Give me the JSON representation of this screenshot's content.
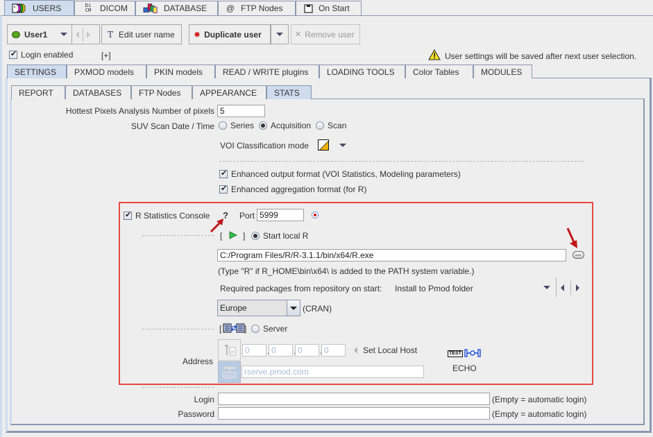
{
  "top_tabs": [
    {
      "label": "USERS",
      "icon": "users-faces-icon",
      "active": true
    },
    {
      "label": "DICOM",
      "icon": "dicom-icon",
      "active": false
    },
    {
      "label": "DATABASE",
      "icon": "database-icon",
      "active": false
    },
    {
      "label": "FTP Nodes",
      "icon": "at-sign-icon",
      "active": false
    },
    {
      "label": "On Start",
      "icon": "on-start-icon",
      "active": false
    }
  ],
  "toolbar": {
    "user_selected": "User1",
    "user_status_color": "#5aa51e",
    "edit_user_name": "Edit user name",
    "duplicate_user": "Duplicate user",
    "remove_user": "Remove user",
    "edit_icon_glyph": "T",
    "remove_icon_glyph": "✕"
  },
  "login_enabled": {
    "label": "Login enabled",
    "checked": true,
    "expand": "[+]"
  },
  "notice": "User settings will be saved after next user selection.",
  "settings_tabs": [
    "SETTINGS",
    "PXMOD models",
    "PKIN models",
    "READ / WRITE plugins",
    "LOADING TOOLS",
    "Color Tables",
    "MODULES"
  ],
  "settings_active": "SETTINGS",
  "sub_tabs": [
    "REPORT",
    "DATABASES",
    "FTP Nodes",
    "APPEARANCE",
    "STATS"
  ],
  "sub_active": "STATS",
  "stats": {
    "hottest_label": "Hottest Pixels Analysis Number of pixels",
    "hottest_value": "5",
    "suv_label": "SUV Scan Date / Time",
    "suv_options": [
      "Series",
      "Acquisition",
      "Scan"
    ],
    "suv_selected": "Acquisition",
    "voi_label": "VOI Classification mode",
    "enhanced_output": {
      "label": "Enhanced output format (VOI Statistics, Modeling parameters)",
      "checked": true
    },
    "enhanced_aggregation": {
      "label": "Enhanced aggregation format (for R)",
      "checked": true
    }
  },
  "r_console": {
    "label": "R Statistics Console",
    "checked": true,
    "help": "?",
    "port_label": "Port",
    "port_value": "5999",
    "bracket_open": "[",
    "bracket_close": "]",
    "start_local_label": "Start local R",
    "start_local_selected": true,
    "r_path": "C:/Program Files/R/R-3.1.1/bin/x64/R.exe",
    "path_hint": "(Type \"R\" if R_HOME\\bin\\x64\\ is added to the PATH system variable.)",
    "packages_label": "Required packages from repository on start:",
    "packages_value": "Install to Pmod folder",
    "mirror_value": "Europe",
    "mirror_suffix": "(CRAN)",
    "server_label": "Server",
    "server_selected": false,
    "address_label": "Address",
    "ip": [
      "0",
      "0",
      "0",
      "0"
    ],
    "set_local_host": "Set Local Host",
    "host_value": "rserve.pmod.com",
    "echo_label": "ECHO",
    "test_glyph": "TEST"
  },
  "credentials": {
    "login_label": "Login",
    "login_value": "",
    "password_label": "Password",
    "password_value": "",
    "hint": "(Empty = automatic login)"
  },
  "colors": {
    "highlight_box": "#e8493f",
    "active_tab": "#cfdcee",
    "annotation_arrow": "#c0161b"
  }
}
